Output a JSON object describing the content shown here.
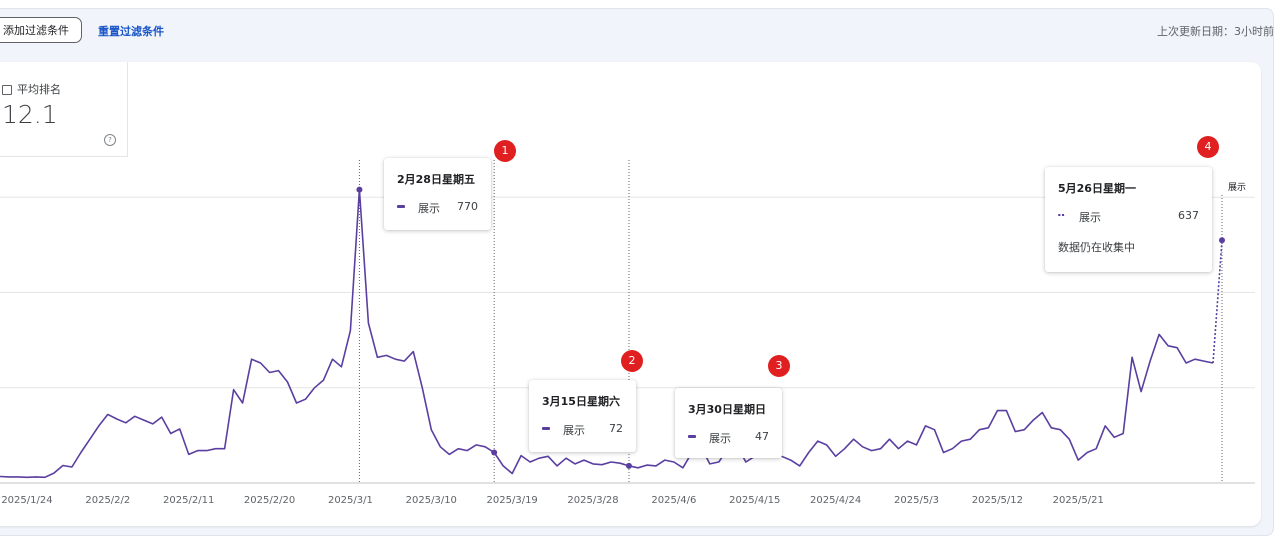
{
  "toolbar": {
    "add_filter_label": "添加过滤条件",
    "reset_filter_label": "重置过滤条件",
    "last_update": "上次更新日期：3小时前"
  },
  "metric": {
    "label": "平均排名",
    "value": "12.1",
    "help_icon": "help-circle-icon"
  },
  "chart_data": {
    "type": "line",
    "series": [
      {
        "name": "展示",
        "color": "#5a3fa0",
        "values": [
          17,
          16,
          16,
          15,
          16,
          15,
          26,
          46,
          42,
          80,
          115,
          150,
          180,
          168,
          158,
          175,
          165,
          155,
          173,
          130,
          142,
          75,
          85,
          85,
          90,
          90,
          245,
          210,
          325,
          315,
          290,
          295,
          265,
          210,
          220,
          250,
          270,
          325,
          305,
          400,
          770,
          420,
          330,
          335,
          325,
          320,
          345,
          250,
          140,
          95,
          75,
          90,
          85,
          100,
          95,
          80,
          45,
          25,
          72,
          55,
          65,
          70,
          45,
          65,
          50,
          60,
          50,
          48,
          55,
          52,
          45,
          40,
          47,
          45,
          60,
          55,
          40,
          80,
          95,
          50,
          55,
          90,
          100,
          55,
          70,
          75,
          80,
          70,
          60,
          45,
          80,
          110,
          100,
          70,
          90,
          115,
          95,
          85,
          90,
          115,
          90,
          110,
          100,
          150,
          140,
          80,
          90,
          110,
          115,
          140,
          145,
          190,
          190,
          135,
          140,
          165,
          185,
          145,
          140,
          115,
          60,
          80,
          90,
          150,
          120,
          130,
          330,
          240,
          320,
          390,
          360,
          355,
          315,
          325,
          320,
          315,
          637
        ]
      }
    ],
    "x_tick_labels": [
      "2025/1/24",
      "2025/2/2",
      "2025/2/11",
      "2025/2/20",
      "2025/3/1",
      "2025/3/10",
      "2025/3/19",
      "2025/3/28",
      "2025/4/6",
      "2025/4/15",
      "2025/4/24",
      "2025/5/3",
      "2025/5/12",
      "2025/5/21"
    ],
    "ylim": [
      0,
      1000
    ],
    "grid": true,
    "right_axis_label": "展示",
    "markers": [
      40,
      55,
      70,
      136
    ],
    "tooltips": [
      {
        "index": 40,
        "date": "2月28日星期五",
        "series": "展示",
        "value": "770",
        "badge": "1"
      },
      {
        "index": 55,
        "date": "3月15日星期六",
        "series": "展示",
        "value": "72",
        "badge": "2"
      },
      {
        "index": 70,
        "date": "3月30日星期日",
        "series": "展示",
        "value": "47",
        "badge": "3"
      },
      {
        "index": 136,
        "date": "5月26日星期一",
        "series": "展示",
        "value": "637",
        "note": "数据仍在收集中",
        "badge": "4"
      }
    ]
  }
}
